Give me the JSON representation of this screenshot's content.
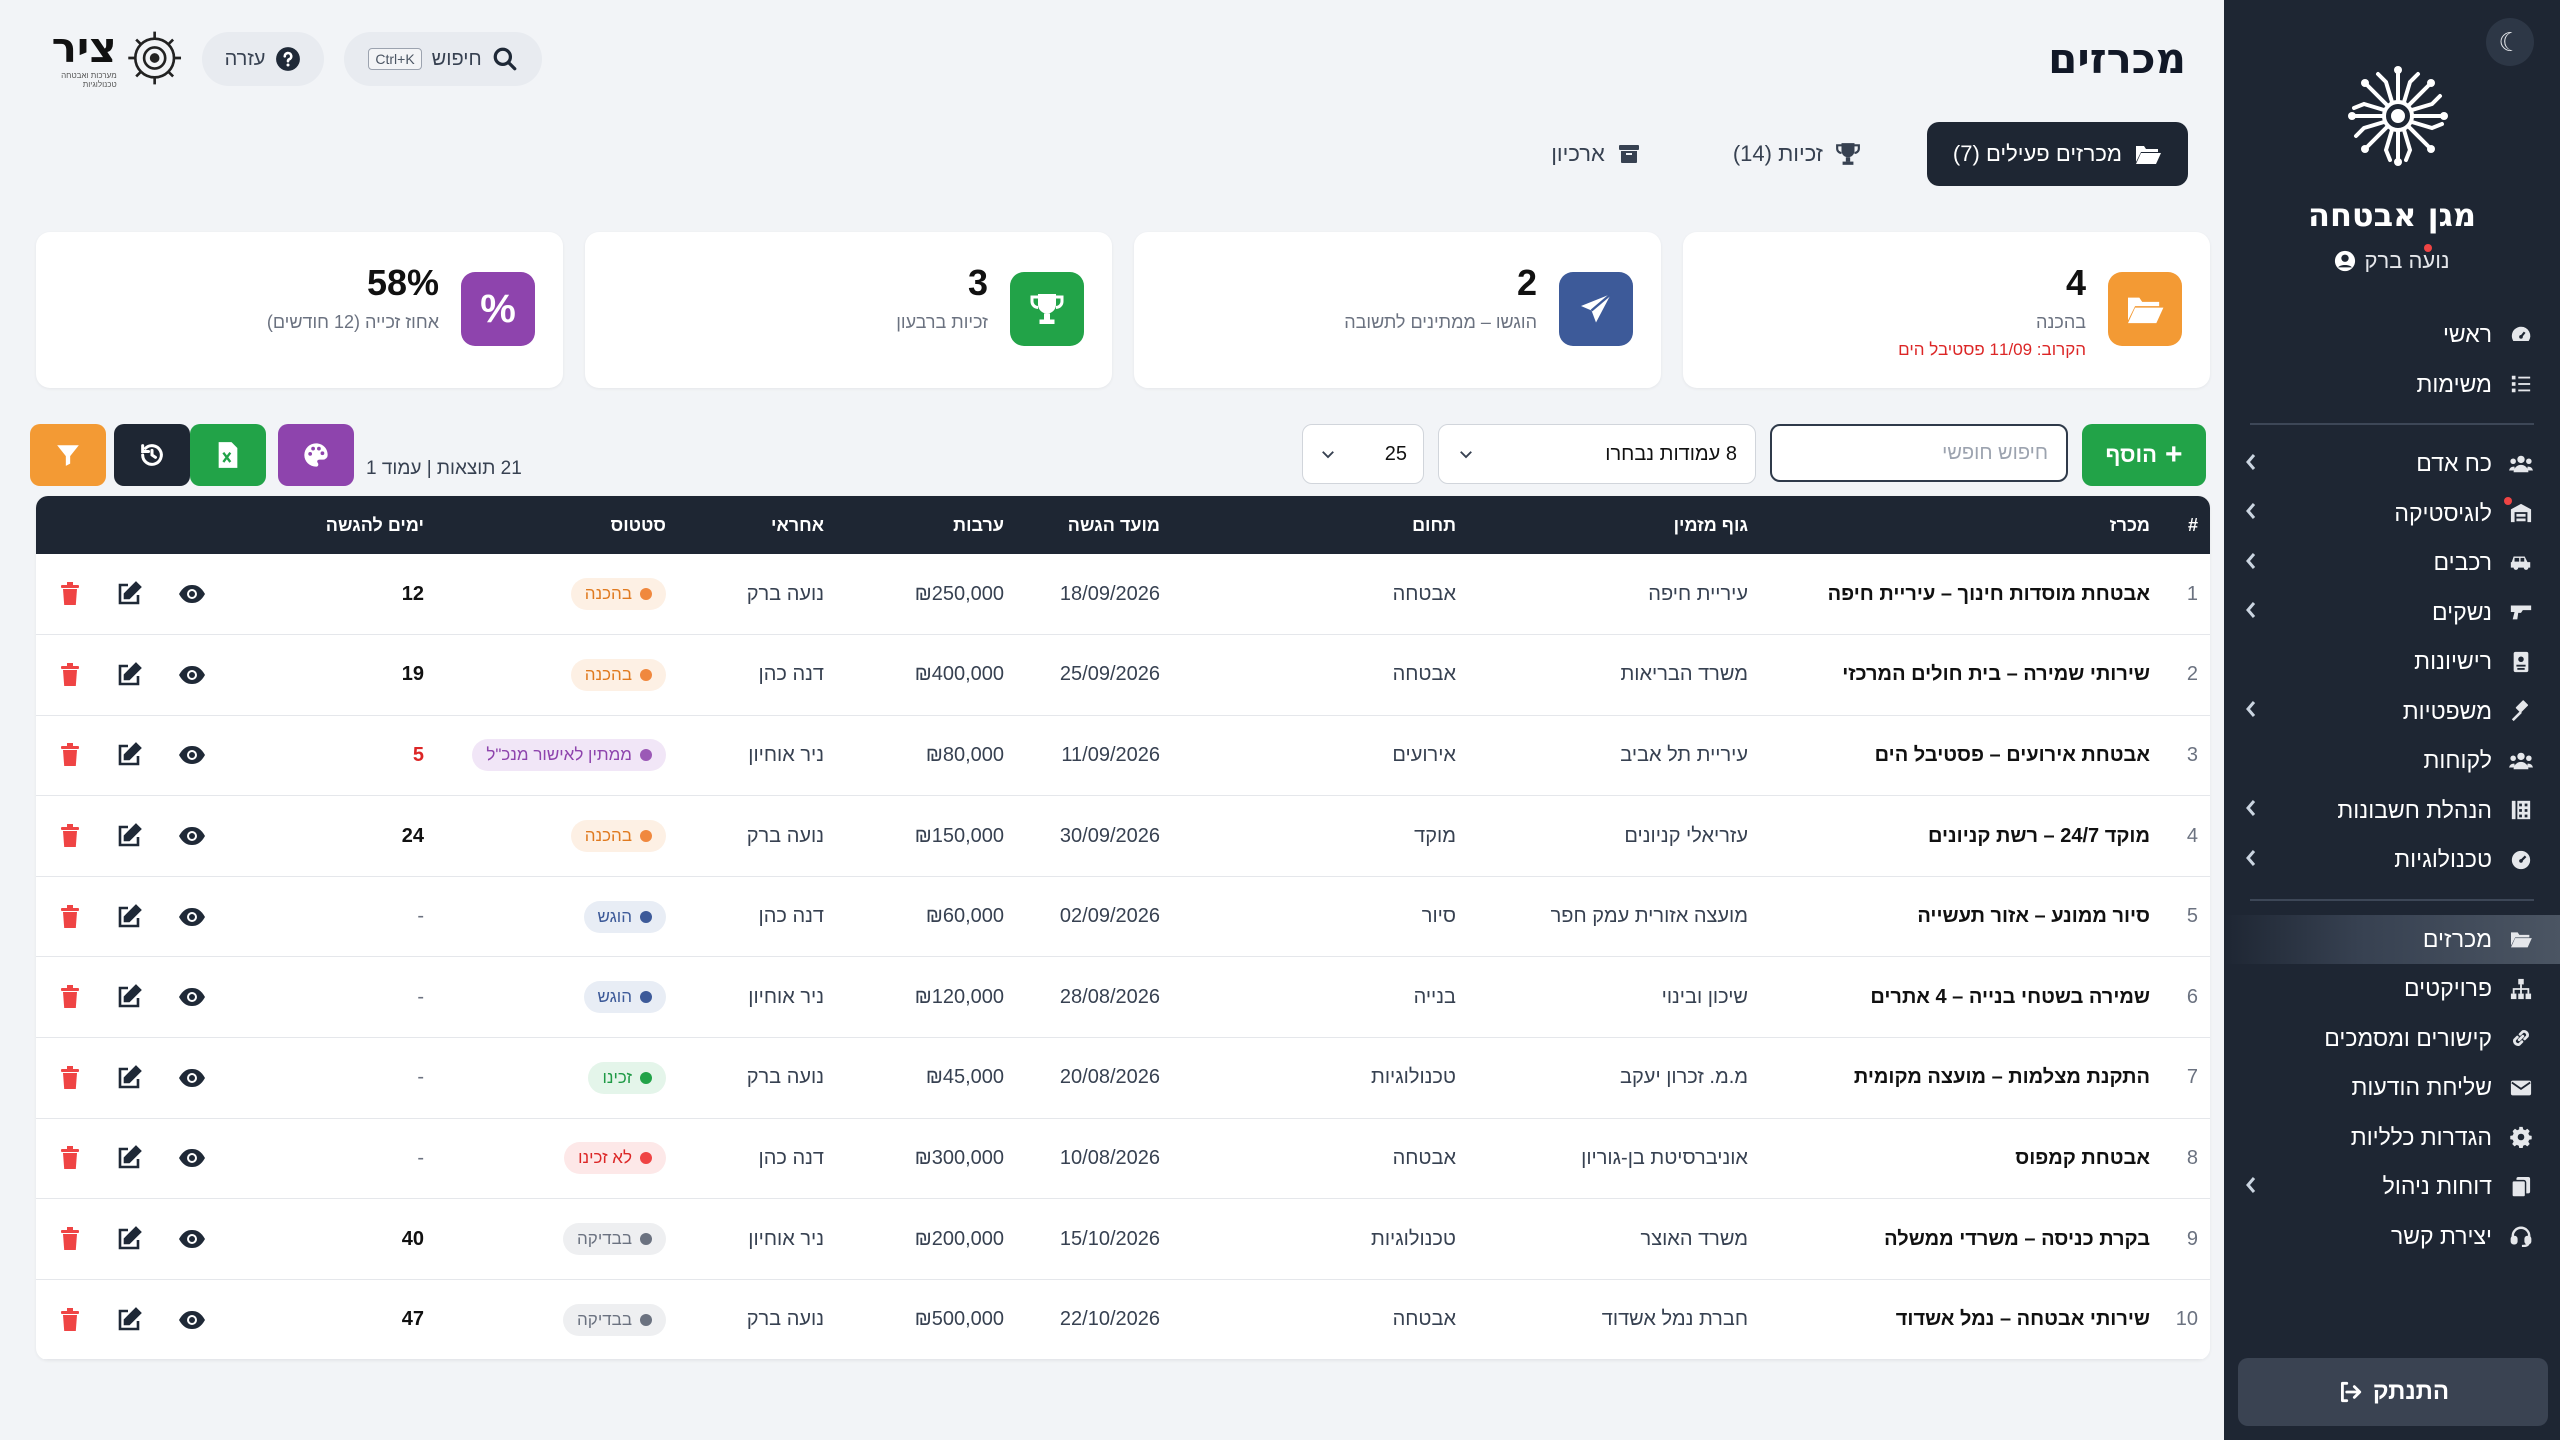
{
  "sidebar": {
    "brand_name": "מגן אבטחה",
    "user_name": "נועה ברק",
    "items": [
      {
        "label": "ראשי",
        "icon": "dashboard-icon",
        "chevron": false
      },
      {
        "label": "משימות",
        "icon": "tasks-icon",
        "chevron": false
      },
      {
        "label": "כח אדם",
        "icon": "users-icon",
        "chevron": true
      },
      {
        "label": "לוגיסטיקה",
        "icon": "warehouse-icon",
        "chevron": true
      },
      {
        "label": "רכבים",
        "icon": "car-icon",
        "chevron": true
      },
      {
        "label": "נשקים",
        "icon": "gun-icon",
        "chevron": true
      },
      {
        "label": "רישיונות",
        "icon": "id-card-icon",
        "chevron": false
      },
      {
        "label": "משפטיות",
        "icon": "gavel-icon",
        "chevron": true
      },
      {
        "label": "לקוחות",
        "icon": "clients-icon",
        "chevron": false
      },
      {
        "label": "הנהלת חשבונות",
        "icon": "calculator-icon",
        "chevron": true
      },
      {
        "label": "טכנולוגיות",
        "icon": "gauge-icon",
        "chevron": true
      },
      {
        "label": "מכרזים",
        "icon": "folder-open-icon",
        "chevron": false
      },
      {
        "label": "פרויקטים",
        "icon": "sitemap-icon",
        "chevron": false
      },
      {
        "label": "קישורים ומסמכים",
        "icon": "link-icon",
        "chevron": false
      },
      {
        "label": "שליחת הודעות",
        "icon": "envelope-icon",
        "chevron": false
      },
      {
        "label": "הגדרות כלליות",
        "icon": "gear-icon",
        "chevron": false
      },
      {
        "label": "דוחות ניהול",
        "icon": "copy-icon",
        "chevron": true
      },
      {
        "label": "יצירת קשר",
        "icon": "headset-icon",
        "chevron": false
      }
    ],
    "logout_label": "התנתק"
  },
  "header": {
    "title": "מכרזים",
    "search_label": "חיפוש",
    "search_shortcut": "Ctrl+K",
    "help_label": "עזרה",
    "logo_text": "ציר",
    "logo_sub": "מערכות ואבטחה טכנולוגיות"
  },
  "tabs": [
    {
      "label": "מכרזים פעילים (7)",
      "icon": "folder-open-icon"
    },
    {
      "label": "זכיות (14)",
      "icon": "trophy-icon"
    },
    {
      "label": "ארכיון",
      "icon": "archive-icon"
    }
  ],
  "stats": [
    {
      "value": "4",
      "label": "בהכנה",
      "note": "הקרוב: 11/09 פסטיבל הים",
      "color": "#f39a34",
      "icon": "folder-open-icon"
    },
    {
      "value": "2",
      "label": "הוגשו – ממתינים לתשובה",
      "note": "",
      "color": "#3d5a99",
      "icon": "paper-plane-icon"
    },
    {
      "value": "3",
      "label": "זכיות ברבעון",
      "note": "",
      "color": "#22a348",
      "icon": "trophy-icon"
    },
    {
      "value": "58%",
      "label": "אחוז זכייה (12 חודשים)",
      "note": "",
      "color": "#8e44ad",
      "icon": "percent-icon"
    }
  ],
  "toolbar": {
    "add_label": "הוסף",
    "search_placeholder": "חיפוש חופשי",
    "columns_selected": "8 עמודות נבחרו",
    "per_page": "25",
    "results_text": "21 תוצאות | עמוד 1"
  },
  "table": {
    "headers": [
      "#",
      "מכרז",
      "גוף מזמין",
      "תחום",
      "מועד הגשה",
      "ערבות",
      "אחראי",
      "סטטוס",
      "ימים להגשה",
      ""
    ],
    "rows": [
      {
        "num": "1",
        "tender": "אבטחת מוסדות חינוך – עיריית חיפה",
        "client": "עיריית חיפה",
        "field": "אבטחה",
        "date": "18/09/2026",
        "bond": "₪250,000",
        "owner": "נועה ברק",
        "status": "בהכנה",
        "skey": "prep",
        "days": "12"
      },
      {
        "num": "2",
        "tender": "שירותי שמירה – בית חולים המרכזי",
        "client": "משרד הבריאות",
        "field": "אבטחה",
        "date": "25/09/2026",
        "bond": "₪400,000",
        "owner": "דנה כהן",
        "status": "בהכנה",
        "skey": "prep",
        "days": "19"
      },
      {
        "num": "3",
        "tender": "אבטחת אירועים – פסטיבל הים",
        "client": "עיריית תל אביב",
        "field": "אירועים",
        "date": "11/09/2026",
        "bond": "₪80,000",
        "owner": "ניר אוחיון",
        "status": "ממתין לאישור מנכ\"ל",
        "skey": "wait",
        "days": "5"
      },
      {
        "num": "4",
        "tender": "מוקד 24/7 – רשת קניונים",
        "client": "עזריאלי קניונים",
        "field": "מוקד",
        "date": "30/09/2026",
        "bond": "₪150,000",
        "owner": "נועה ברק",
        "status": "בהכנה",
        "skey": "prep",
        "days": "24"
      },
      {
        "num": "5",
        "tender": "סיור ממונע – אזור תעשייה",
        "client": "מועצה אזורית עמק חפר",
        "field": "סיור",
        "date": "02/09/2026",
        "bond": "₪60,000",
        "owner": "דנה כהן",
        "status": "הוגש",
        "skey": "sub",
        "days": "-"
      },
      {
        "num": "6",
        "tender": "שמירה בשטחי בנייה – 4 אתרים",
        "client": "שיכון ובינוי",
        "field": "בנייה",
        "date": "28/08/2026",
        "bond": "₪120,000",
        "owner": "ניר אוחיון",
        "status": "הוגש",
        "skey": "sub",
        "days": "-"
      },
      {
        "num": "7",
        "tender": "התקנת מצלמות – מועצה מקומית",
        "client": "מ.מ. זכרון יעקב",
        "field": "טכנולוגיות",
        "date": "20/08/2026",
        "bond": "₪45,000",
        "owner": "נועה ברק",
        "status": "זכינו",
        "skey": "won",
        "days": "-"
      },
      {
        "num": "8",
        "tender": "אבטחת קמפוס",
        "client": "אוניברסיטת בן-גוריון",
        "field": "אבטחה",
        "date": "10/08/2026",
        "bond": "₪300,000",
        "owner": "דנה כהן",
        "status": "לא זכינו",
        "skey": "lost",
        "days": "-"
      },
      {
        "num": "9",
        "tender": "בקרת כניסה – משרדי ממשלה",
        "client": "משרד האוצר",
        "field": "טכנולוגיות",
        "date": "15/10/2026",
        "bond": "₪200,000",
        "owner": "ניר אוחיון",
        "status": "בבדיקה",
        "skey": "rev",
        "days": "40"
      },
      {
        "num": "10",
        "tender": "שירותי אבטחה – נמל אשדוד",
        "client": "חברת נמל אשדוד",
        "field": "אבטחה",
        "date": "22/10/2026",
        "bond": "₪500,000",
        "owner": "נועה ברק",
        "status": "בבדיקה",
        "skey": "rev",
        "days": "47"
      }
    ]
  },
  "colors": {
    "sidebar_bg": "#1e2633",
    "add": "#22a348",
    "filter": "#f39a34",
    "reset": "#1e2633",
    "excel": "#22a348",
    "palette": "#8e44ad",
    "delete": "#ef4444"
  }
}
